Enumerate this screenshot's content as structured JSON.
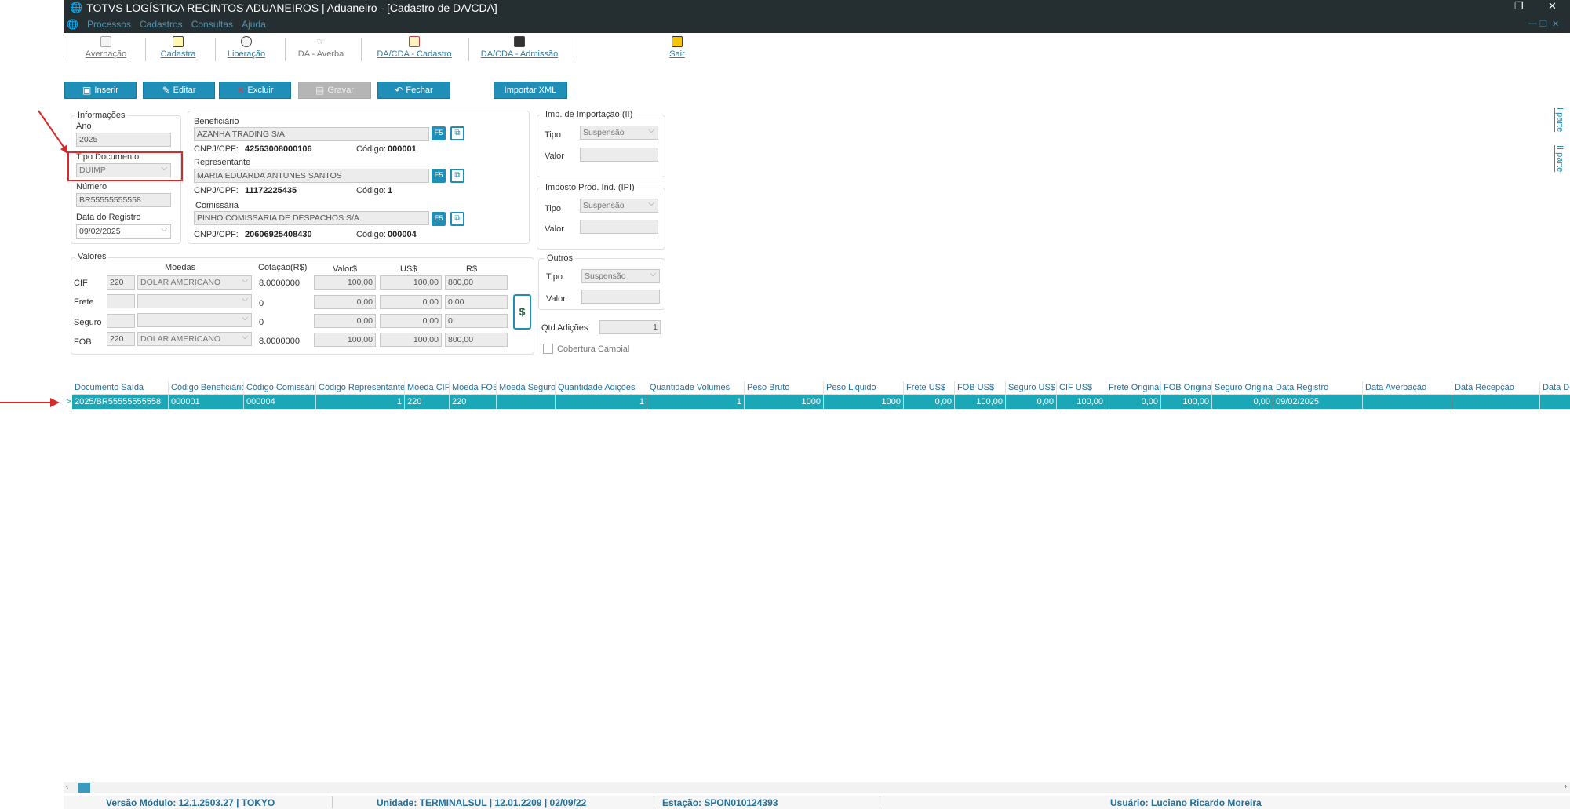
{
  "window": {
    "title": "TOTVS LOGÍSTICA RECINTOS ADUANEIROS | Aduaneiro - [Cadastro de DA/CDA]",
    "minimize": "—",
    "restore": "❐",
    "close": "✕",
    "child_min": "—",
    "child_restore": "❐",
    "child_close": "✕"
  },
  "menu": [
    "Processos",
    "Cadastros",
    "Consultas",
    "Ajuda"
  ],
  "toolbar": {
    "averbacao": "Averbação",
    "cadastra": "Cadastra",
    "liberacao": "Liberação",
    "da_averba": "DA - Averba",
    "dacda_cadastro": "DA/CDA - Cadastro",
    "dacda_admissao": "DA/CDA - Admissão",
    "sair": "Sair"
  },
  "actions": {
    "inserir": "Inserir",
    "editar": "Editar",
    "excluir": "Excluir",
    "gravar": "Gravar",
    "fechar": "Fechar",
    "importar_xml": "Importar XML"
  },
  "informacoes": {
    "group": "Informações",
    "ano_label": "Ano",
    "ano": "2025",
    "tipo_label": "Tipo Documento",
    "tipo": "DUIMP",
    "numero_label": "Número",
    "numero": "BR55555555558",
    "data_label": "Data do Registro",
    "data": "09/02/2025"
  },
  "partes": {
    "cnpj_label": "CNPJ/CPF:",
    "codigo_label": "Código:",
    "f5": "F5",
    "beneficiario_label": "Beneficiário",
    "beneficiario": "AZANHA TRADING S/A.",
    "beneficiario_cnpj": "42563008000106",
    "beneficiario_codigo": "000001",
    "representante_label": "Representante",
    "representante": "MARIA EDUARDA ANTUNES SANTOS",
    "representante_cnpj": "11172225435",
    "representante_codigo": "1",
    "comissaria_label": "Comissária",
    "comissaria": "PINHO COMISSARIA DE DESPACHOS S/A.",
    "comissaria_cnpj": "20606925408430",
    "comissaria_codigo": "000004"
  },
  "impostos": {
    "ii_group": "Imp. de Importação (II)",
    "ipi_group": "Imposto Prod. Ind. (IPI)",
    "outros_group": "Outros",
    "tipo_label": "Tipo",
    "valor_label": "Valor",
    "ii_tipo": "Suspensão",
    "ipi_tipo": "Suspensão",
    "outros_tipo": "Suspensão",
    "qtd_adicoes_label": "Qtd Adições",
    "qtd_adicoes": "1",
    "cobertura_label": "Cobertura Cambial"
  },
  "valores": {
    "group": "Valores",
    "col_moedas": "Moedas",
    "col_cotacao": "Cotação(R$)",
    "col_valor": "Valor$",
    "col_us": "US$",
    "col_rs": "R$",
    "dollar_button": "$",
    "rows": [
      {
        "label": "CIF",
        "code": "220",
        "moeda": "DOLAR AMERICANO",
        "cotacao": "8.0000000",
        "valor": "100,00",
        "us": "100,00",
        "rs": "800,00"
      },
      {
        "label": "Frete",
        "code": "",
        "moeda": "",
        "cotacao": "0",
        "valor": "0,00",
        "us": "0,00",
        "rs": "0,00"
      },
      {
        "label": "Seguro",
        "code": "",
        "moeda": "",
        "cotacao": "0",
        "valor": "0,00",
        "us": "0,00",
        "rs": "0"
      },
      {
        "label": "FOB",
        "code": "220",
        "moeda": "DOLAR AMERICANO",
        "cotacao": "8.0000000",
        "valor": "100,00",
        "us": "100,00",
        "rs": "800,00"
      }
    ]
  },
  "side_tabs": {
    "parte1": "I parte",
    "parte2": "II parte"
  },
  "grid": {
    "row_indicator": ">",
    "columns": [
      "Documento Saída",
      "Código Beneficiário",
      "Código Comissária",
      "Código Representante",
      "Moeda CIF",
      "Moeda FOB",
      "Moeda Seguro",
      "Quantidade Adições",
      "Quantidade Volumes",
      "Peso Bruto",
      "Peso Liquido",
      "Frete US$",
      "FOB US$",
      "Seguro US$",
      "CIF US$",
      "Frete Original",
      "FOB Original",
      "Seguro Original",
      "Data Registro",
      "Data Averbação",
      "Data Recepção",
      "Data De"
    ],
    "rows": [
      [
        "2025/BR55555555558",
        "000001",
        "000004",
        "1",
        "220",
        "220",
        "",
        "1",
        "1",
        "1000",
        "1000",
        "0,00",
        "100,00",
        "0,00",
        "100,00",
        "0,00",
        "100,00",
        "0,00",
        "09/02/2025",
        "",
        "",
        ""
      ]
    ]
  },
  "statusbar": {
    "versao": "Versão Módulo:  12.1.2503.27  |  TOKYO",
    "unidade": "Unidade:  TERMINALSUL | 12.01.2209 | 02/09/22",
    "estacao": "Estação:  SPON010124393",
    "usuario": "Usuário:  Luciano Ricardo Moreira"
  },
  "colors": {
    "titlebar": "#252f31",
    "accent": "#1f8fb8",
    "selected_row": "#1aa7b8",
    "highlight": "#d62b2b"
  }
}
